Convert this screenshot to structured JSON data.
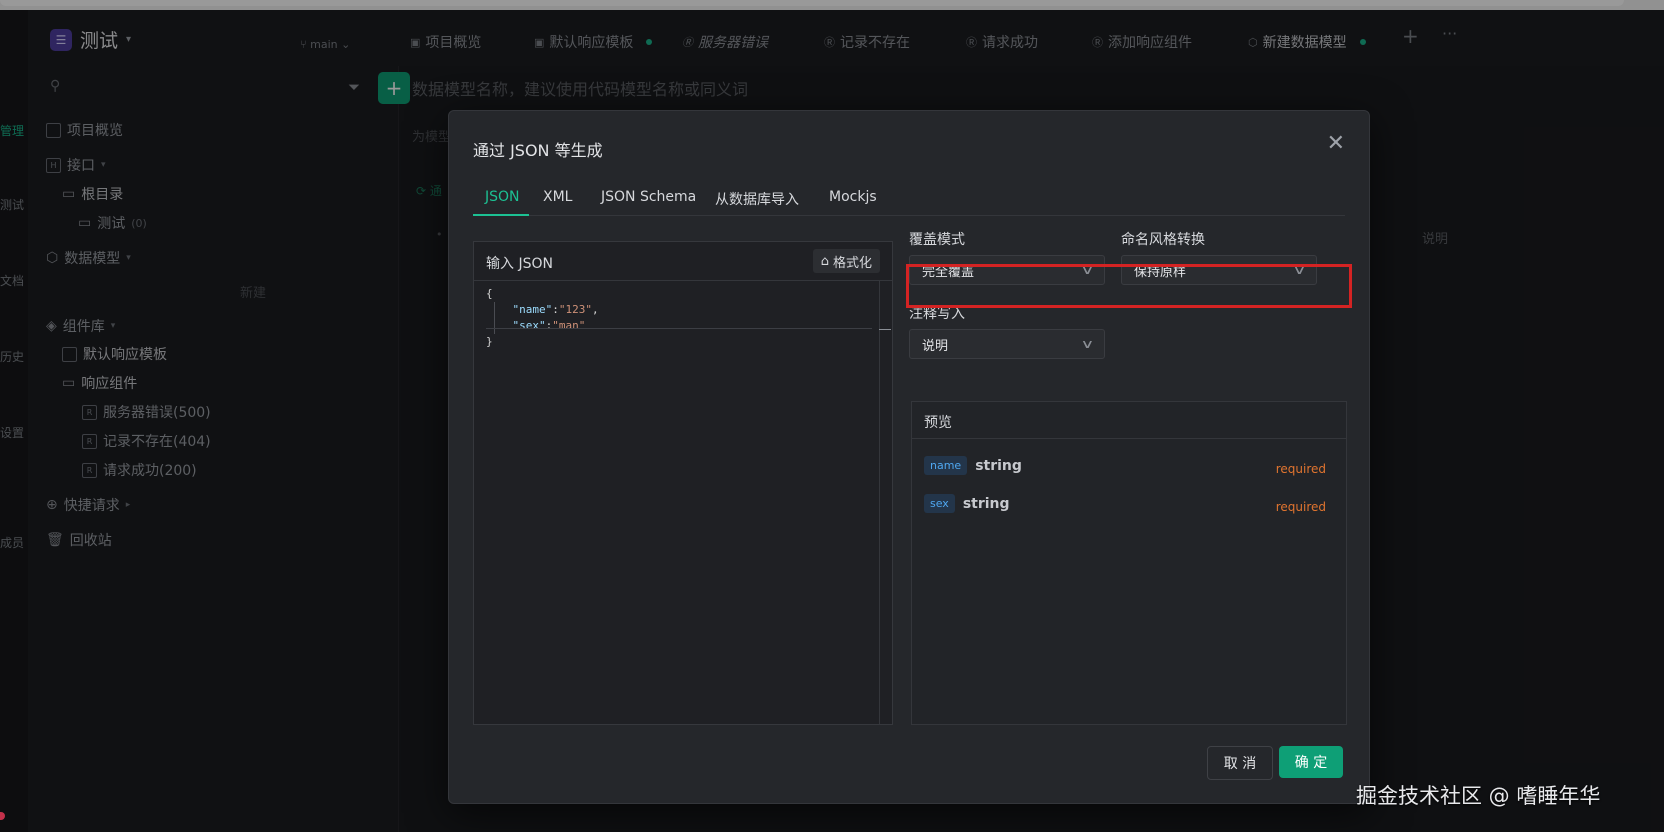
{
  "app": {
    "project_name": "测试",
    "branch": "main",
    "rail_labels": [
      "管理",
      "测试",
      "文档",
      "历史",
      "设置",
      "成员"
    ]
  },
  "sidebar": {
    "items": [
      {
        "label": "项目概览"
      },
      {
        "label": "接口"
      },
      {
        "label": "根目录"
      },
      {
        "label": "测试",
        "count": "(0)"
      },
      {
        "label": "数据模型"
      },
      {
        "label": "组件库"
      },
      {
        "label": "默认响应模板"
      },
      {
        "label": "响应组件"
      },
      {
        "label": "服务器错误(500)"
      },
      {
        "label": "记录不存在(404)"
      },
      {
        "label": "请求成功(200)"
      },
      {
        "label": "快捷请求"
      },
      {
        "label": "回收站"
      }
    ],
    "new_hint": "新建"
  },
  "tabs": [
    {
      "label": "项目概览"
    },
    {
      "label": "默认响应模板"
    },
    {
      "label": "服务器错误"
    },
    {
      "label": "记录不存在"
    },
    {
      "label": "请求成功"
    },
    {
      "label": "添加响应组件"
    },
    {
      "label": "新建数据模型"
    }
  ],
  "main": {
    "name_placeholder": "数据模型名称，建议使用代码模型名称或同义词",
    "hint2": "为模型",
    "hint3": "通",
    "col_desc": "说明"
  },
  "modal": {
    "title": "通过 JSON 等生成",
    "tabs": [
      "JSON",
      "XML",
      "JSON Schema",
      "从数据库导入",
      "Mockjs"
    ],
    "active_tab": "JSON",
    "editor": {
      "title": "输入 JSON",
      "format_label": "格式化",
      "code_open": "{",
      "code_key1": "\"name\"",
      "code_val1": "\"123\"",
      "code_key2": "\"sex\"",
      "code_val2": "\"man\"",
      "code_close": "}"
    },
    "override_mode": {
      "label": "覆盖模式",
      "value": "完全覆盖"
    },
    "naming_style": {
      "label": "命名风格转换",
      "value": "保持原样"
    },
    "comment_write": {
      "label": "注释写入",
      "value": "说明"
    },
    "preview": {
      "title": "预览",
      "fields": [
        {
          "name": "name",
          "type": "string",
          "required": "required"
        },
        {
          "name": "sex",
          "type": "string",
          "required": "required"
        }
      ]
    },
    "cancel_label": "取 消",
    "ok_label": "确 定"
  },
  "watermark": "掘金技术社区 @ 嗜睡年华",
  "colors": {
    "accent": "#0e9f76",
    "highlight": "#d42323",
    "required": "#e0742f"
  }
}
